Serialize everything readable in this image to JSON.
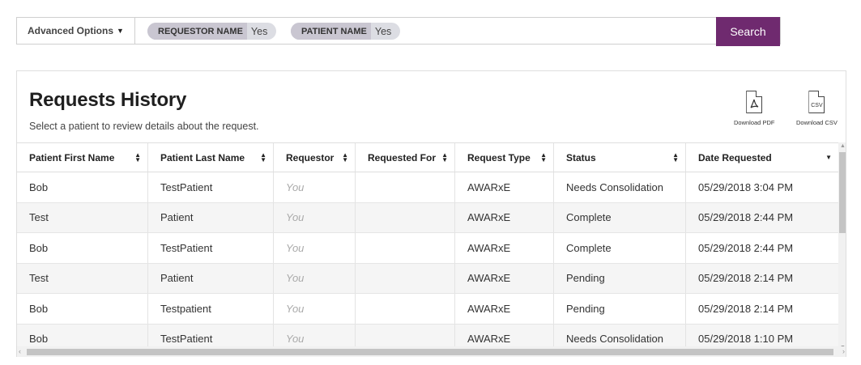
{
  "search": {
    "advanced_label": "Advanced Options",
    "chips": [
      {
        "key": "REQUESTOR NAME",
        "value": "Yes"
      },
      {
        "key": "PATIENT NAME",
        "value": "Yes"
      }
    ],
    "button_label": "Search"
  },
  "panel": {
    "title": "Requests History",
    "subtitle": "Select a patient to review details about the request.",
    "downloads": {
      "pdf_label": "Download PDF",
      "csv_label": "Download CSV",
      "csv_glyph": "CSV"
    }
  },
  "table": {
    "headers": [
      "Patient First Name",
      "Patient Last Name",
      "Requestor",
      "Requested For",
      "Request Type",
      "Status",
      "Date Requested"
    ],
    "rows": [
      [
        "Bob",
        "TestPatient",
        "You",
        "",
        "AWARxE",
        "Needs Consolidation",
        "05/29/2018 3:04 PM"
      ],
      [
        "Test",
        "Patient",
        "You",
        "",
        "AWARxE",
        "Complete",
        "05/29/2018 2:44 PM"
      ],
      [
        "Bob",
        "TestPatient",
        "You",
        "",
        "AWARxE",
        "Complete",
        "05/29/2018 2:44 PM"
      ],
      [
        "Test",
        "Patient",
        "You",
        "",
        "AWARxE",
        "Pending",
        "05/29/2018 2:14 PM"
      ],
      [
        "Bob",
        "Testpatient",
        "You",
        "",
        "AWARxE",
        "Pending",
        "05/29/2018 2:14 PM"
      ],
      [
        "Bob",
        "TestPatient",
        "You",
        "",
        "AWARxE",
        "Needs Consolidation",
        "05/29/2018 1:10 PM"
      ]
    ]
  },
  "colors": {
    "accent": "#6f2a6f",
    "chip_key_bg": "#c9c6d1",
    "chip_bg": "#dcdde3"
  }
}
